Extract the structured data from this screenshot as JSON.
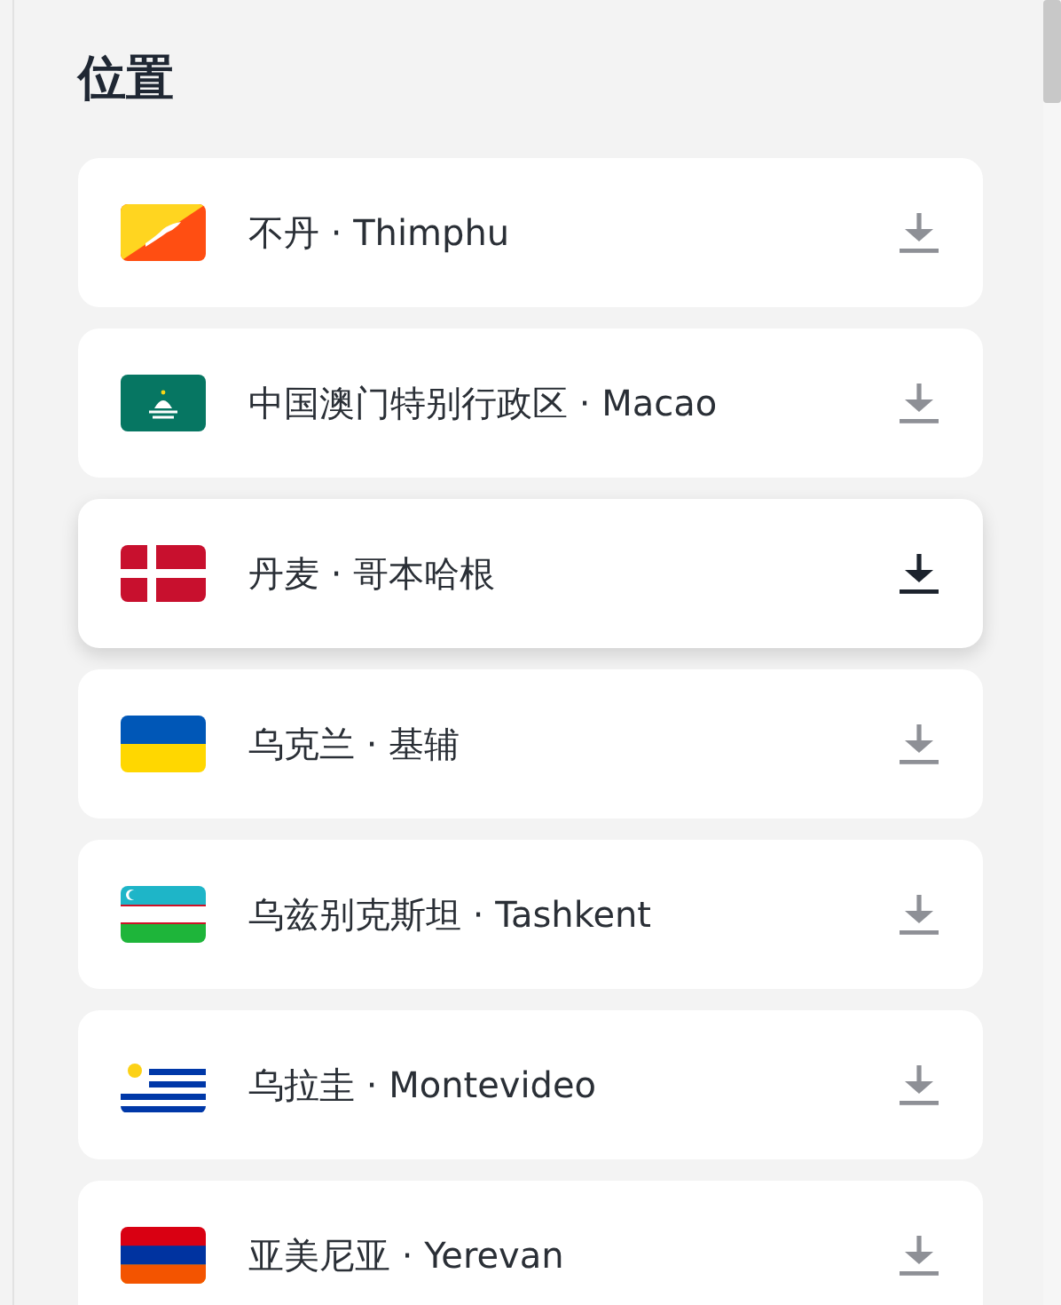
{
  "title": "位置",
  "locations": [
    {
      "kind": "bhutan",
      "label": "不丹 · Thimphu",
      "hovered": false
    },
    {
      "kind": "macao",
      "label": "中国澳门特别行政区 · Macao",
      "hovered": false
    },
    {
      "kind": "denmark",
      "label": "丹麦 · 哥本哈根",
      "hovered": true
    },
    {
      "kind": "ukraine",
      "label": "乌克兰 · 基辅",
      "hovered": false
    },
    {
      "kind": "uzbekistan",
      "label": "乌兹别克斯坦 · Tashkent",
      "hovered": false
    },
    {
      "kind": "uruguay",
      "label": "乌拉圭 · Montevideo",
      "hovered": false
    },
    {
      "kind": "armenia",
      "label": "亚美尼亚 · Yerevan",
      "hovered": false
    }
  ]
}
